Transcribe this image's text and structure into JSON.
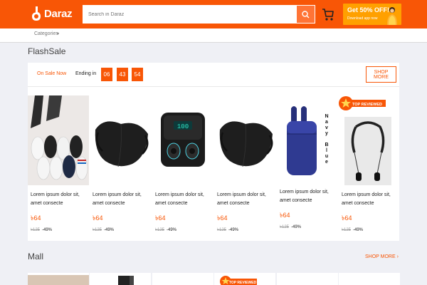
{
  "header": {
    "logo_text": "Daraz",
    "search_placeholder": "Search in Daraz",
    "promo_title": "Get 50% OFF!",
    "promo_subtitle": "Download app now"
  },
  "nav": {
    "categories_label": "Categories"
  },
  "flash_sale": {
    "title": "FlashSale",
    "on_sale_label": "On Sale Now",
    "ending_label": "Ending in",
    "timer": [
      "06",
      "43",
      "54"
    ],
    "shop_more_label": "SHOP MORE",
    "products": [
      {
        "image": "socks",
        "name": "Lorem ipsum dolor sit, amet consecte",
        "price": "৳64",
        "old_price": "৳125",
        "discount": "-49%"
      },
      {
        "image": "face-mask",
        "name": "Lorem ipsum dolor sit, amet consecte",
        "price": "৳64",
        "old_price": "৳125",
        "discount": "-49%"
      },
      {
        "image": "wireless-earbuds",
        "name": "Lorem ipsum dolor sit, amet consecte",
        "price": "৳64",
        "old_price": "৳125",
        "discount": "-49%"
      },
      {
        "image": "face-mask",
        "name": "Lorem ipsum dolor sit, amet consecte",
        "price": "৳64",
        "old_price": "৳125",
        "discount": "-49%"
      },
      {
        "image": "earbuds-case-navy",
        "image_caption": "Navy Blue",
        "name": "Lorem ipsum dolor sit, amet consecte",
        "price": "৳64",
        "old_price": "৳125",
        "discount": "-49%"
      },
      {
        "image": "neckband-earphones",
        "badge": "TOP REVIEWED",
        "name": "Lorem ipsum dolor sit, amet consecte",
        "price": "৳64",
        "old_price": "৳125",
        "discount": "-49%"
      }
    ]
  },
  "mall": {
    "title": "Mall",
    "shop_more_label": "SHOP MORE",
    "badge": "TOP REVIEWED"
  },
  "colors": {
    "brand": "#f85606",
    "background": "#eff0f5",
    "promo": "#ffa000"
  },
  "icons": [
    "daraz-logo-icon",
    "search-icon",
    "cart-icon",
    "chevron-down-icon",
    "chevron-right-icon",
    "star-badge-icon"
  ]
}
